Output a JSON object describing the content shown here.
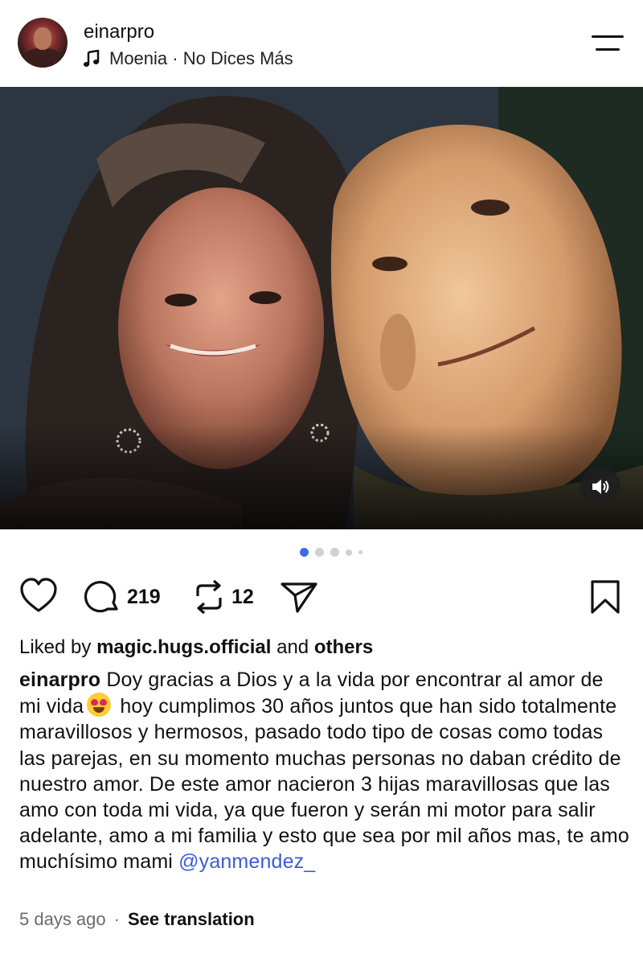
{
  "header": {
    "username": "einarpro",
    "music": "Moenia · No Dices Más"
  },
  "carousel": {
    "total": 5,
    "active_index": 0
  },
  "actions": {
    "comments": "219",
    "reposts": "12"
  },
  "liked": {
    "prefix": "Liked by",
    "user": "magic.hugs.official",
    "and": "and",
    "others": "others"
  },
  "caption": {
    "username": "einarpro",
    "text_before_emoji": "Doy gracias a Dios y a la vida por encontrar al amor de mi vida",
    "emoji": "heart-eyes-emoji",
    "text_after_emoji": "hoy cumplimos 30 años juntos que han sido totalmente maravillosos y hermosos, pasado todo tipo de cosas como todas las parejas, en su momento muchas personas no daban crédito de nuestro amor. De este amor nacieron 3 hijas maravillosas que las amo con toda mi vida, ya que fueron y serán mi motor para salir adelante, amo a mi familia y esto que sea por mil años mas, te amo muchísimo mami",
    "mention": "@yanmendez_"
  },
  "meta": {
    "time": "5 days ago",
    "separator": "·",
    "translate": "See translation"
  },
  "colors": {
    "accent": "#3d6ae8",
    "mention": "#3b5bdb",
    "muted": "#6b6b6b"
  }
}
